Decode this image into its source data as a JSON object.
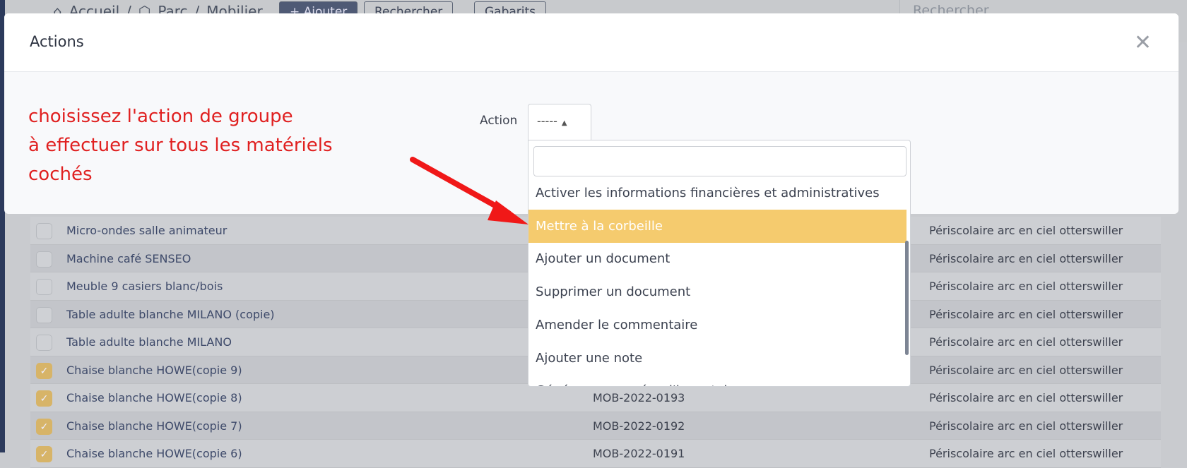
{
  "breadcrumb": [
    "Accueil",
    "Parc",
    "Mobilier"
  ],
  "toolbar": {
    "add": "+ Ajouter",
    "search": "Rechercher",
    "templates": "Gabarits"
  },
  "top_search_placeholder": "Rechercher",
  "modal": {
    "title": "Actions",
    "note_lines": [
      "choisissez l'action de groupe",
      "à effectuer sur tous les matériels",
      "cochés"
    ],
    "action_label": "Action",
    "select_value": "-----",
    "search_value": "",
    "options": [
      "Activer les informations financières et administratives",
      "Mettre à la corbeille",
      "Ajouter un document",
      "Supprimer un document",
      "Amender le commentaire",
      "Ajouter une note",
      "Générer un numéro d'inventaire"
    ],
    "highlighted_option": "Mettre à la corbeille",
    "highlight_color": "#f5cb6e"
  },
  "rows": [
    {
      "name": "Micro-ondes salle animateur",
      "code": "",
      "location": "Périscolaire arc en ciel otterswiller",
      "checked": false
    },
    {
      "name": "Machine café SENSEO",
      "code": "",
      "location": "Périscolaire arc en ciel otterswiller",
      "checked": false
    },
    {
      "name": "Meuble 9 casiers blanc/bois",
      "code": "",
      "location": "Périscolaire arc en ciel otterswiller",
      "checked": false
    },
    {
      "name": "Table adulte blanche MILANO (copie)",
      "code": "",
      "location": "Périscolaire arc en ciel otterswiller",
      "checked": false
    },
    {
      "name": "Table adulte blanche MILANO",
      "code": "",
      "location": "Périscolaire arc en ciel otterswiller",
      "checked": false
    },
    {
      "name": "Chaise blanche HOWE(copie 9)",
      "code": "",
      "location": "Périscolaire arc en ciel otterswiller",
      "checked": true
    },
    {
      "name": "Chaise blanche HOWE(copie 8)",
      "code": "MOB-2022-0193",
      "location": "Périscolaire arc en ciel otterswiller",
      "checked": true
    },
    {
      "name": "Chaise blanche HOWE(copie 7)",
      "code": "MOB-2022-0192",
      "location": "Périscolaire arc en ciel otterswiller",
      "checked": true
    },
    {
      "name": "Chaise blanche HOWE(copie 6)",
      "code": "MOB-2022-0191",
      "location": "Périscolaire arc en ciel otterswiller",
      "checked": true
    }
  ]
}
